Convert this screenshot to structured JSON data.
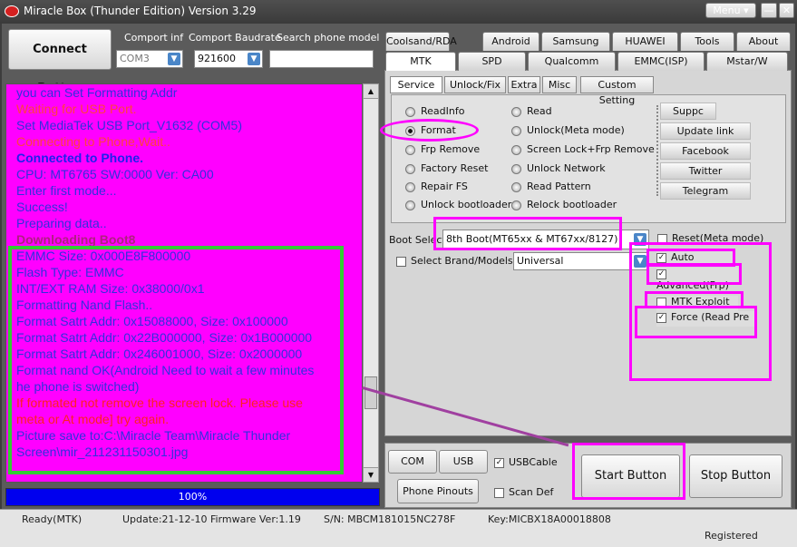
{
  "window": {
    "title": "Miracle Box (Thunder Edition) Version 3.29",
    "menu_label": "Menu ▾",
    "minimize": "—",
    "restore": "❐",
    "close": "✕"
  },
  "top": {
    "connect_label": "Connect Button",
    "comport_label": "Comport inf",
    "comport_value": "COM3",
    "baud_label": "Comport Baudrate",
    "baud_value": "921600",
    "search_label": "Search phone model",
    "search_value": ""
  },
  "log": {
    "lines": [
      {
        "text": "you can Set Formatting Addr",
        "color": "#3030dd"
      },
      {
        "text": "Waiting for USB Port.",
        "color": "#ff4040"
      },
      {
        "text": "Set MediaTek USB Port_V1632 (COM5)",
        "color": "#3030dd"
      },
      {
        "text": "Connecting to Phone,Wait..",
        "color": "#ff4040"
      },
      {
        "text": "Connected to Phone.",
        "color": "#2020ee",
        "bold": true
      },
      {
        "text": "CPU: MT6765 SW:0000 Ver: CA00",
        "color": "#3030dd"
      },
      {
        "text": "Enter first mode...",
        "color": "#3030dd"
      },
      {
        "text": "Success!",
        "color": "#3030dd"
      },
      {
        "text": "Preparing data..",
        "color": "#3030dd"
      },
      {
        "text": "Downloading Boot8",
        "color": "#b02080",
        "bold": true
      },
      {
        "text": "EMMC Size: 0x000E8F800000",
        "color": "#3030dd"
      },
      {
        "text": "Flash Type: EMMC",
        "color": "#3030dd"
      },
      {
        "text": "INT/EXT RAM  Size: 0x38000/0x1",
        "color": "#3030dd"
      },
      {
        "text": "Formatting Nand Flash..",
        "color": "#3030dd"
      },
      {
        "text": "Format Satrt Addr: 0x15088000, Size: 0x100000",
        "color": "#3030dd"
      },
      {
        "text": "Format Satrt Addr: 0x22B000000, Size: 0x1B000000",
        "color": "#3030dd"
      },
      {
        "text": "Format Satrt Addr: 0x246001000, Size: 0x2000000",
        "color": "#3030dd"
      },
      {
        "text": "Format nand OK(Android Need to wait a few minutes",
        "color": "#3030dd"
      },
      {
        "text": "he phone is switched)",
        "color": "#3030dd"
      },
      {
        "text": "If formated not remove the screen lock. Please use",
        "color": "#ff2020"
      },
      {
        "text": "meta or At mode] try again.",
        "color": "#ff2020"
      },
      {
        "text": "Picture save to:C:\\Miracle Team\\Miracle Thunder",
        "color": "#3030dd"
      },
      {
        "text": "Screen\\mir_211231150301.jpg",
        "color": "#3030dd"
      }
    ]
  },
  "progress": {
    "label": "100%",
    "value": 100
  },
  "tabs_row1": [
    "Coolsand/RDA",
    "Android",
    "Samsung",
    "HUAWEI",
    "Tools",
    "About"
  ],
  "tabs_row2": [
    "MTK",
    "SPD",
    "Qualcomm",
    "EMMC(ISP)",
    "Mstar/W"
  ],
  "subtabs": [
    "Service",
    "Unlock/Fix",
    "Extra",
    "Misc",
    "Custom Setting"
  ],
  "service": {
    "col1": [
      "ReadInfo",
      "Format",
      "Frp Remove",
      "Factory Reset",
      "Repair FS",
      "Unlock bootloader"
    ],
    "col2": [
      "Read",
      "Unlock(Meta mode)",
      "Screen Lock+Frp Remove",
      "Unlock Network",
      "Read Pattern",
      "Relock bootloader"
    ],
    "selected": "Format",
    "side_buttons": [
      "Suppc",
      "Update link",
      "Facebook",
      "Twitter",
      "Telegram"
    ]
  },
  "boot": {
    "boot_label": "Boot Select:",
    "boot_value": "8th Boot(MT65xx & MT67xx/8127)",
    "brand_label": "Select Brand/Models",
    "brand_value": "Universal",
    "reset_meta": "Reset(Meta mode)",
    "auto": "Auto",
    "advanced": "Advanced(Frp)",
    "mtk_exploit": "MTK Exploit",
    "force": "Force (Read Pre"
  },
  "bottom": {
    "com_scan": "COM Scan",
    "usb_scan": "USB Scan",
    "usb_cable": "USBCable",
    "phone_pinouts": "Phone Pinouts",
    "scan_def": "Scan Def",
    "start": "Start Button",
    "stop": "Stop Button"
  },
  "status": {
    "state": "Ready(MTK)",
    "update": "Update:21-12-10  Firmware Ver:1.19",
    "sn": "S/N: MBCM181015NC278F",
    "key": "Key:MICBX18A00018808",
    "registered": "Registered"
  },
  "colors": {
    "log_bg": "#ff00ff",
    "highlight": "#ff00ff",
    "green_box": "#33cc33",
    "progress": "#0000ee"
  }
}
